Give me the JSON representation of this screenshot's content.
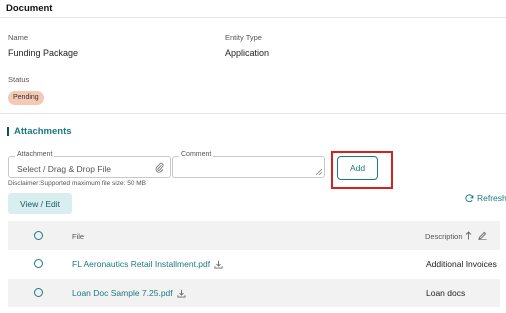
{
  "header": {
    "title": "Document"
  },
  "details": {
    "name_label": "Name",
    "name_value": "Funding Package",
    "entity_type_label": "Entity Type",
    "entity_type_value": "Application",
    "status_label": "Status",
    "status_value": "Pending",
    "status_color": "#f6c9b4"
  },
  "attachments": {
    "title": "Attachments",
    "attachment_label": "Attachment",
    "attachment_placeholder": "Select / Drag & Drop File",
    "comment_label": "Comment",
    "disclaimer": "Disclaimer:Supported maximum file size: 50 MB",
    "add_label": "Add",
    "view_edit_label": "View / Edit",
    "refresh_label": "Refresh",
    "accent_color": "#1a7a82",
    "highlight_color": "#d42222"
  },
  "table": {
    "columns": {
      "file": "File",
      "description": "Description"
    },
    "rows": [
      {
        "file": "FL Aeronautics Retail Installment.pdf",
        "description": "Additional Invoices"
      },
      {
        "file": "Loan Doc Sample 7.25.pdf",
        "description": "Loan docs"
      }
    ]
  }
}
